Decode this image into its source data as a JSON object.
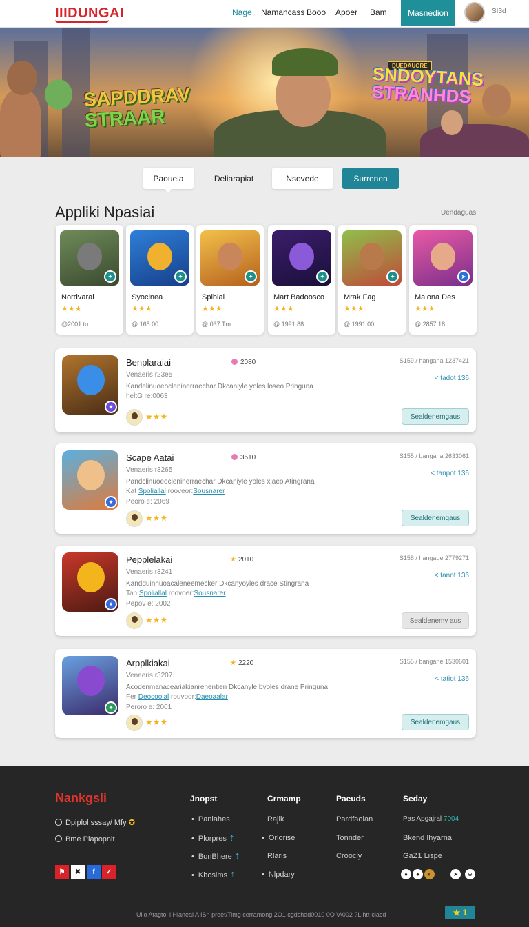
{
  "header": {
    "logo": "IIIDUNGAI",
    "nav": [
      "Nage",
      "Namancass",
      "Booo",
      "Apoer",
      "Bam"
    ],
    "cta": "Masnedion",
    "user_text": "SI3d"
  },
  "hero": {
    "title_left_1": "SAPDDRAV",
    "title_left_2": "STRAAR",
    "badge": "DUEDAUORE",
    "title_right_1": "SNDOYTANS",
    "title_right_2": "STRANHDS"
  },
  "tabs": [
    "Paouela",
    "Deliarapiat",
    "Nsovede",
    "Surrenen"
  ],
  "section": {
    "title": "Appliki Npasiai",
    "link": "Uendaguas"
  },
  "apps": [
    {
      "name": "Nordvarai",
      "stars": "★★★",
      "meta": "@2001 to"
    },
    {
      "name": "Syoclnea",
      "stars": "★★★",
      "meta": "@ 165.00"
    },
    {
      "name": "Splbial",
      "stars": "★★★",
      "meta": "@ 037 Tm"
    },
    {
      "name": "Mart Badoosco",
      "stars": "★★★",
      "meta": "@ 1991 88"
    },
    {
      "name": "Mrak Fag",
      "stars": "★★★",
      "meta": "@ 1991 00"
    },
    {
      "name": "Malona Des",
      "stars": "★★★",
      "meta": "@ 2857 18"
    }
  ],
  "listings": [
    {
      "title": "Benplaraiai",
      "rating": "2080",
      "rating_style": "dot",
      "sub": "Venaeris r23e5",
      "desc": "Kandelinuoeocleninerraechar Dkcaniyle yoles loseo Pringuna",
      "row3_a": "heltG re:0063",
      "row3_link": "",
      "row4": "",
      "price": "S159 / hangana 1237421",
      "plink": "< tadot 136",
      "cta": "Sealdenemgaus",
      "cta_style": "teal"
    },
    {
      "title": "Scape Aatai",
      "rating": "3510",
      "rating_style": "dot",
      "sub": "Venaeris r3265",
      "desc": "Pandclinuoeocleninerraechar Dkcaniyle yoles xiaeo Atingrana",
      "row3_a": "Kat ",
      "row3_link": "Spoliallal",
      "row3_b": " rooveor:",
      "row3_link2": "Sousnarer",
      "row4": "Peoro e: 2069",
      "price": "S155 / bangaria 2633061",
      "plink": "< tanpot 136",
      "cta": "Sealdenemgaus",
      "cta_style": "teal"
    },
    {
      "title": "Pepplelakai",
      "rating": "2010",
      "rating_style": "star",
      "sub": "Venaeris r3241",
      "desc": "Kandduinhuoacaleneemecker Dkcanyoyles drace Stingrana",
      "row3_a": "Tan ",
      "row3_link": "Spoliallal",
      "row3_b": " roovoer:",
      "row3_link2": "Sousnarer",
      "row4": "Pepov e: 2002",
      "price": "S158 / hangage 2779271",
      "plink": "< tanot 136",
      "cta": "Sealdenemy aus",
      "cta_style": "grey"
    },
    {
      "title": "Arpplkiakai",
      "rating": "2220",
      "rating_style": "star",
      "sub": "Venaeris r3207",
      "desc": "Acodenmanaceariakianrenentien Dkcanyle byoles drane Pringuna",
      "row3_a": "Fer ",
      "row3_link": "Deocoolal",
      "row3_b": " rouvoor:",
      "row3_link2": "Daeoaalar",
      "row4": "Peroro e: 2001",
      "price": "S155 / bangane 1530601",
      "plink": "< tatiot 136",
      "cta": "Sealdenemgaus",
      "cta_style": "teal"
    }
  ],
  "footer": {
    "logo": "Nankgsli",
    "item1": "Dpiplol sssay/ Mfy",
    "item2": "Bme Plapopnit",
    "col_heads": [
      "Jnopst",
      "Crmamp",
      "Paeuds",
      "Seday"
    ],
    "col1": [
      "Panlahes",
      "Plorpres",
      "BonBhere",
      "Kbosims"
    ],
    "col2": [
      "Rajik",
      "Orlorise",
      "Rlaris",
      "Nlpdary"
    ],
    "col3": [
      "Pardfaoian",
      "Tonnder",
      "Croocly"
    ],
    "col4_1a": "Pas Apgajral",
    "col4_1b": " 7004",
    "col4_2": "Bkend Ihyarna",
    "col4_3": "GaZ1 Lispe",
    "socials": [
      "⚑",
      "✖",
      "f",
      "✓"
    ],
    "circles": [
      "●",
      "●",
      "◐",
      "➤",
      "⊕"
    ],
    "copyright": "Ullo Atagtol l Hianeal A  ISn proet/Timg cerramong 2O1 cgdchad0010 0O \\A002 ?Llhtt-clacd",
    "badge": "★ 1"
  },
  "colors": {
    "accent": "#1f8597",
    "brand_red": "#d8232a",
    "star": "#f2b51c"
  }
}
